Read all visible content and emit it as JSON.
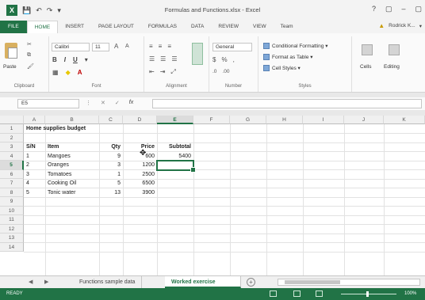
{
  "window": {
    "title": "Formulas and Functions.xlsx - Excel",
    "controls": [
      "?",
      "▢",
      "–",
      "▢"
    ]
  },
  "tabs": [
    "FILE",
    "HOME",
    "INSERT",
    "PAGE LAYOUT",
    "FORMULAS",
    "DATA",
    "REVIEW",
    "VIEW",
    "Team"
  ],
  "active_tab": "HOME",
  "user": "Rodrick K...",
  "ribbon": {
    "clipboard": {
      "paste": "Paste",
      "label": "Clipboard"
    },
    "font": {
      "name": "Calibri",
      "size": "11",
      "label": "Font"
    },
    "alignment": {
      "label": "Alignment"
    },
    "number": {
      "format": "General",
      "label": "Number"
    },
    "styles": {
      "conditional": "Conditional Formatting ▾",
      "table": "Format as Table ▾",
      "cell": "Cell Styles ▾",
      "label": "Styles"
    },
    "cells": "Cells",
    "editing": "Editing"
  },
  "formula_bar": {
    "name_box": "E5",
    "fx": "fx",
    "value": ""
  },
  "columns": [
    "A",
    "B",
    "C",
    "D",
    "E",
    "F",
    "G",
    "H",
    "I",
    "J",
    "K"
  ],
  "selected_column": "E",
  "rows": [
    "1",
    "2",
    "3",
    "4",
    "5",
    "6",
    "7",
    "8",
    "9",
    "10",
    "11",
    "12",
    "13",
    "14"
  ],
  "selected_row": "5",
  "cells": {
    "title": "Home supplies budget",
    "headers": {
      "sn": "S/N",
      "item": "Item",
      "qty": "Qty",
      "price": "Price",
      "subtotal": "Subtotal"
    },
    "items": [
      {
        "sn": "1",
        "item": "Mangoes",
        "qty": "9",
        "price": "600",
        "subtotal": "5400"
      },
      {
        "sn": "2",
        "item": "Oranges",
        "qty": "3",
        "price": "1200",
        "subtotal": ""
      },
      {
        "sn": "3",
        "item": "Tomatoes",
        "qty": "1",
        "price": "2500",
        "subtotal": ""
      },
      {
        "sn": "4",
        "item": "Cooking Oil",
        "qty": "5",
        "price": "6500",
        "subtotal": ""
      },
      {
        "sn": "5",
        "item": "Tonic water",
        "qty": "13",
        "price": "3900",
        "subtotal": ""
      }
    ]
  },
  "sheets": [
    "Functions sample data",
    "Worked exercise"
  ],
  "active_sheet": "Worked exercise",
  "status": {
    "ready": "READY",
    "zoom": "100%"
  },
  "colors": {
    "excel_green": "#217346"
  }
}
